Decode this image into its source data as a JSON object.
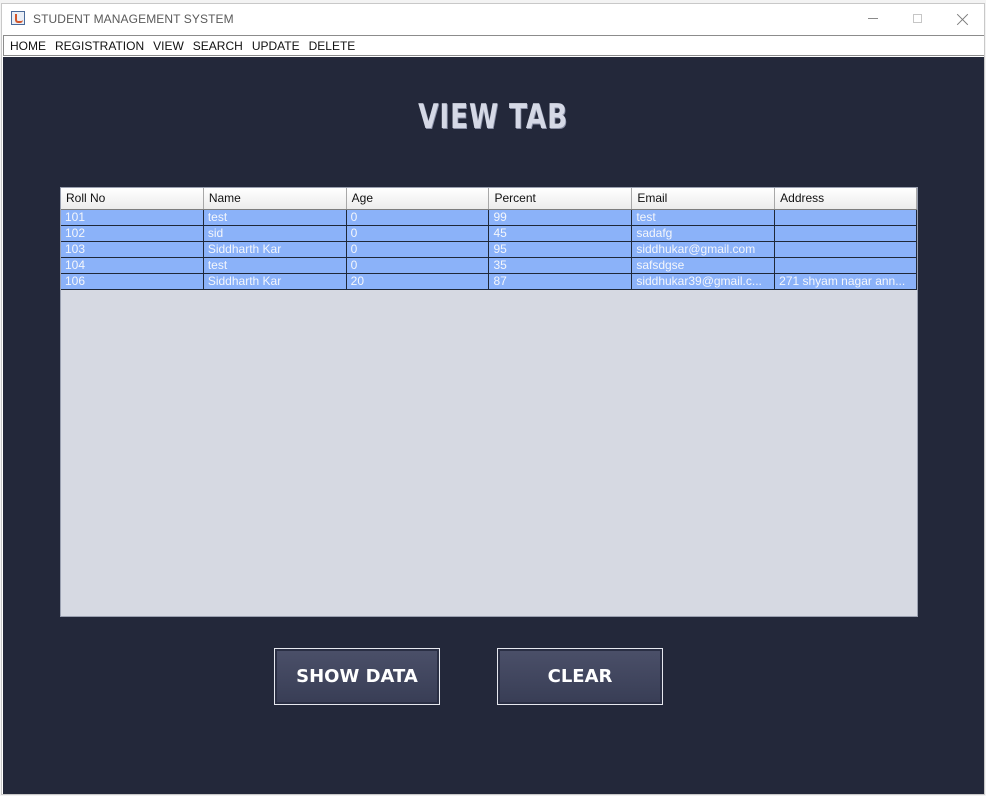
{
  "window": {
    "title": "STUDENT MANAGEMENT SYSTEM"
  },
  "menu": {
    "items": [
      "HOME",
      "REGISTRATION",
      "VIEW",
      "SEARCH",
      "UPDATE",
      "DELETE"
    ]
  },
  "main": {
    "heading": "VIEW TAB",
    "table": {
      "columns": [
        "Roll No",
        "Name",
        "Age",
        "Percent",
        "Email",
        "Address"
      ],
      "rows": [
        [
          "101",
          "test",
          "0",
          "99",
          "test",
          ""
        ],
        [
          "102",
          "sid",
          "0",
          "45",
          "sadafg",
          ""
        ],
        [
          "103",
          "Siddharth Kar",
          "0",
          "95",
          "siddhukar@gmail.com",
          ""
        ],
        [
          "104",
          "test",
          "0",
          "35",
          "safsdgse",
          ""
        ],
        [
          "106",
          "Siddharth Kar",
          "20",
          "87",
          "siddhukar39@gmail.c...",
          "271 shyam nagar ann..."
        ]
      ]
    },
    "buttons": {
      "show_data": "SHOW DATA",
      "clear": "CLEAR"
    }
  },
  "colors": {
    "background": "#23283a",
    "row_selected": "#8bb2f9",
    "table_empty": "#d6d9e2",
    "button": "#41465f"
  },
  "icons": {
    "app": "java-app-icon",
    "minimize": "minimize-icon",
    "maximize": "maximize-icon",
    "close": "close-icon"
  }
}
